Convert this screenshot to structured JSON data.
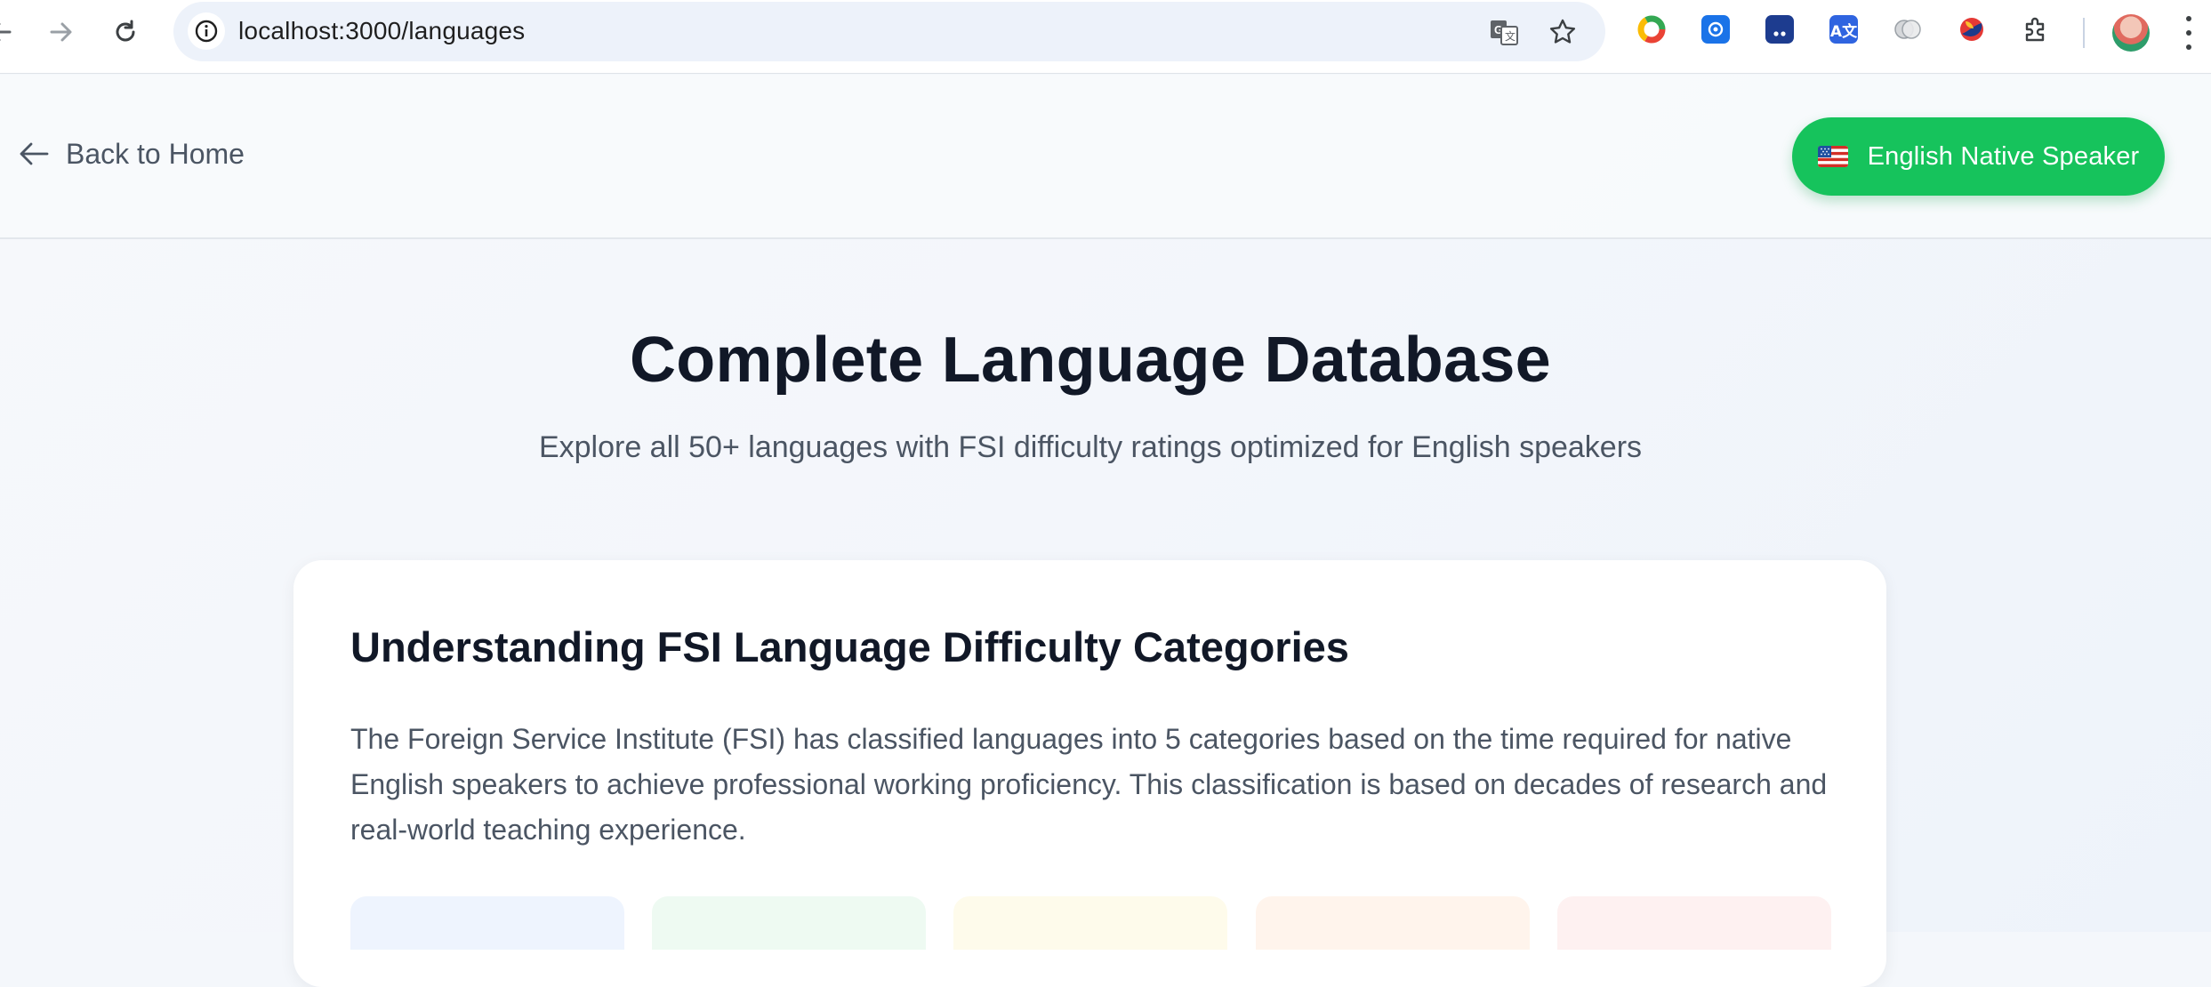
{
  "browser": {
    "url": "localhost:3000/languages"
  },
  "header": {
    "back_label": "Back to Home",
    "native_button": {
      "flag": "us-flag",
      "label": "English Native Speaker"
    }
  },
  "hero": {
    "title": "Complete Language Database",
    "subtitle": "Explore all 50+ languages with FSI difficulty ratings optimized for English speakers"
  },
  "fsi_card": {
    "title": "Understanding FSI Language Difficulty Categories",
    "body": "The Foreign Service Institute (FSI) has classified languages into 5 categories based on the time required for native English speakers to achieve professional working proficiency. This classification is based on decades of research and real-world teaching experience.",
    "category_tiles": [
      {
        "color": "#eef4fe"
      },
      {
        "color": "#eefaf2"
      },
      {
        "color": "#fefbeb"
      },
      {
        "color": "#fff4ec"
      },
      {
        "color": "#fef1f1"
      }
    ]
  },
  "colors": {
    "accent_green": "#16c35c",
    "heading": "#111827",
    "body_text": "#4b5563"
  }
}
